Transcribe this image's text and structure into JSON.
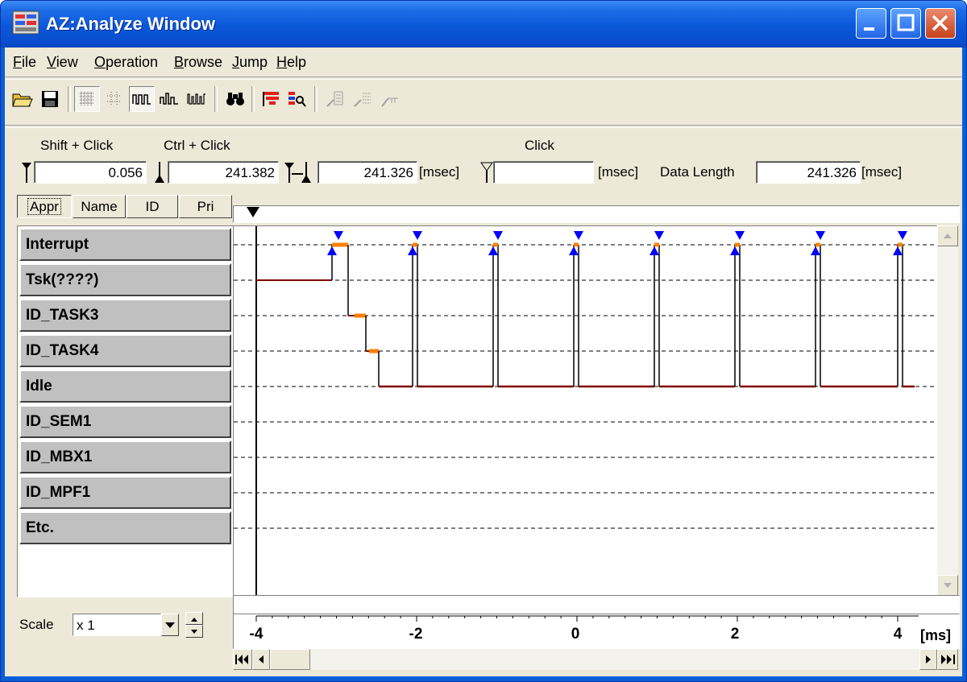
{
  "window": {
    "title": "AZ:Analyze Window"
  },
  "menu": [
    "File",
    "View",
    "Operation",
    "Browse",
    "Jump",
    "Help"
  ],
  "toolbar": {
    "buttons": [
      "open-icon",
      "save-icon",
      "grid-dense-icon",
      "grid-sparse-icon",
      "wave-icon",
      "wave-peak-icon",
      "wave-multi-icon",
      "find-icon",
      "bar-chart-icon",
      "inspect-icon",
      "jump-prev-icon",
      "jump-next-icon",
      "jump-end-icon"
    ]
  },
  "cursors": {
    "shift_label": "Shift + Click",
    "ctrl_label": "Ctrl + Click",
    "click_label": "Click",
    "shift_value": "0.056",
    "ctrl_value": "241.382",
    "diff_value": "241.326",
    "click_value": "",
    "unit1": "[msec]",
    "unit2": "[msec]",
    "data_length_label": "Data Length",
    "data_length_value": "241.326",
    "unit3": "[msec]"
  },
  "columns": [
    "Appr",
    "Name",
    "ID",
    "Pri"
  ],
  "rows": [
    "Interrupt",
    "Tsk(????)",
    "ID_TASK3",
    "ID_TASK4",
    "Idle",
    "ID_SEM1",
    "ID_MBX1",
    "ID_MPF1",
    "Etc."
  ],
  "scale": {
    "label": "Scale",
    "value": "x 1"
  },
  "axis": {
    "ticks": [
      "-4",
      "-2",
      "0",
      "2",
      "4"
    ],
    "unit": "[ms]"
  },
  "colors": {
    "trace": "#800000",
    "marker": "#ff8000",
    "arrow": "#0000ff"
  }
}
